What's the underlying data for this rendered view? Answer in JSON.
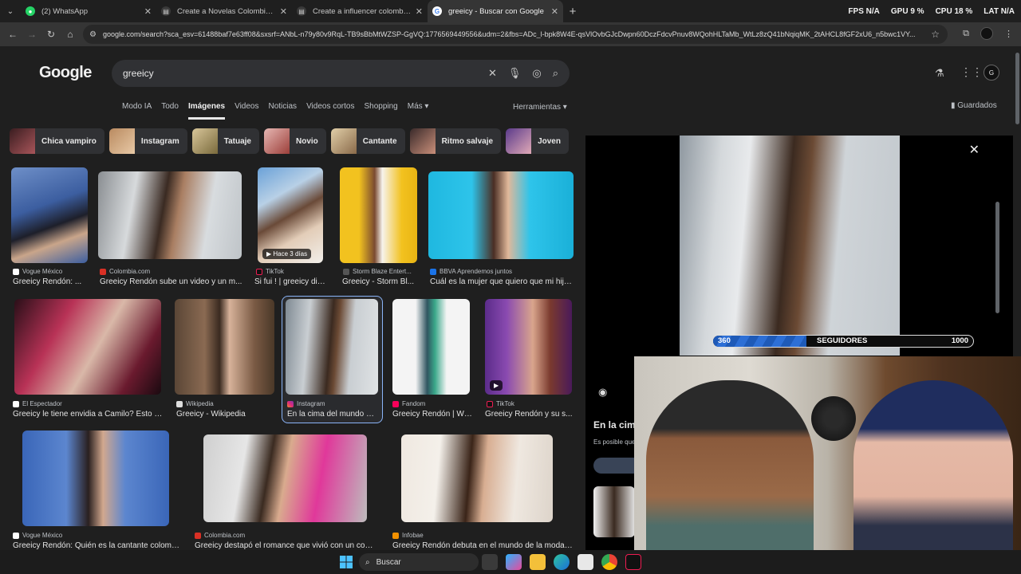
{
  "browser": {
    "tabs": [
      {
        "label": "(2) WhatsApp",
        "color": "#25d366"
      },
      {
        "label": "Create a Novelas Colombianas",
        "color": "#4b6cb7"
      },
      {
        "label": "Create a influencer colombiana",
        "color": "#4b6cb7"
      },
      {
        "label": "greeicy - Buscar con Google",
        "color": "#ffffff"
      }
    ],
    "url": "google.com/search?sca_esv=61488baf7e63ff08&sxsrf=ANbL-n79y80v9RqL-TB9sBbMtWZSP-GgVQ:1776569449556&udm=2&fbs=ADc_l-bpk8W4E-qsVlOvbGJcDwpn60DczFdcvPnuv8WQohHLTaMb_WtLz8zQ41bNqiqMK_2tAHCL8fGF2xU6_n5bwc1VY...",
    "stats": {
      "fps_label": "FPS",
      "fps_value": "N/A",
      "gpu_label": "GPU",
      "gpu_value": "9 %",
      "cpu_label": "CPU",
      "cpu_value": "18 %",
      "lat_label": "LAT",
      "lat_value": "N/A"
    }
  },
  "google": {
    "logo": "Google",
    "query": "greeicy",
    "nav_tabs": [
      "Modo IA",
      "Todo",
      "Imágenes",
      "Videos",
      "Noticias",
      "Videos cortos",
      "Shopping",
      "Más ▾"
    ],
    "tools": "Herramientas ▾",
    "saved": "Guardados",
    "avatar": "G",
    "chips": [
      "Chica vampiro",
      "Instagram",
      "Tatuaje",
      "Novio",
      "Cantante",
      "Ritmo salvaje",
      "Joven"
    ],
    "results": [
      {
        "source": "Vogue México",
        "caption": "Greeicy Rendón: ..."
      },
      {
        "source": "Colombia.com",
        "caption": "Greeicy Rendón sube un video y un m..."
      },
      {
        "source": "TikTok",
        "caption": "Si fui ! | greeicy dis...",
        "badge": "▶ Hace 3 días"
      },
      {
        "source": "Storm Blaze Entert...",
        "caption": "Greeicy - Storm Bl..."
      },
      {
        "source": "BBVA Aprendemos juntos",
        "caption": "Cuál es la mujer que quiero que mi hijo..."
      },
      {
        "source": "El Espectador",
        "caption": "Greeicy le tiene envidia a Camilo? Esto c..."
      },
      {
        "source": "Wikipedia",
        "caption": "Greeicy - Wikipedia"
      },
      {
        "source": "Instagram",
        "caption": "En la cima del mundo c..."
      },
      {
        "source": "Fandom",
        "caption": "Greeicy Rendón | Wi..."
      },
      {
        "source": "TikTok",
        "caption": "Greeicy Rendón y su s...",
        "badge": "▶"
      },
      {
        "source": "Vogue México",
        "caption": "Greeicy Rendón: Quién es la cantante colombi..."
      },
      {
        "source": "Colombia.com",
        "caption": "Greeicy destapó el romance que vivió con un comp..."
      },
      {
        "source": "Infobae",
        "caption": "Greeicy Rendón debuta en el mundo de la moda y..."
      }
    ],
    "panel": {
      "title": "En la cima",
      "subtitle": "Es posible que"
    }
  },
  "overlay": {
    "followers_current": "360",
    "followers_label": "SEGUIDORES",
    "followers_goal": "1000",
    "progress_fraction": 0.36
  },
  "taskbar": {
    "search": "Buscar"
  }
}
